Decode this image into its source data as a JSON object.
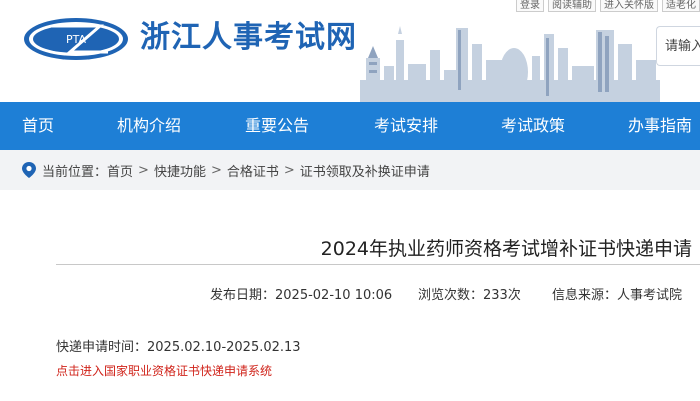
{
  "util_links": [
    "登录",
    "阅读辅助",
    "进入关怀版",
    "适老化"
  ],
  "header": {
    "logo_text": "PTA",
    "site_title": "浙江人事考试网",
    "search_placeholder": "请输入"
  },
  "nav": [
    "首页",
    "机构介绍",
    "重要公告",
    "考试安排",
    "考试政策",
    "办事指南"
  ],
  "breadcrumb": {
    "label": "当前位置：",
    "items": [
      "首页",
      "快捷功能",
      "合格证书",
      "证书领取及补换证申请"
    ],
    "separator": ">"
  },
  "article": {
    "title": "2024年执业药师资格考试增补证书快递申请",
    "publish_label": "发布日期：",
    "publish_date": "2025-02-10 10:06",
    "views_label": "浏览次数：",
    "views": "233次",
    "source_label": "信息来源：",
    "source": "人事考试院",
    "period_label": "快递申请时间：",
    "period": "2025.02.10-2025.02.13",
    "link_text": "点击进入国家职业资格证书快递申请系统"
  },
  "colors": {
    "brand_blue": "#1f64b4",
    "nav_blue": "#1e7fd6",
    "link_red": "#d0241b",
    "breadcrumb_bg": "#f2f3f5"
  }
}
